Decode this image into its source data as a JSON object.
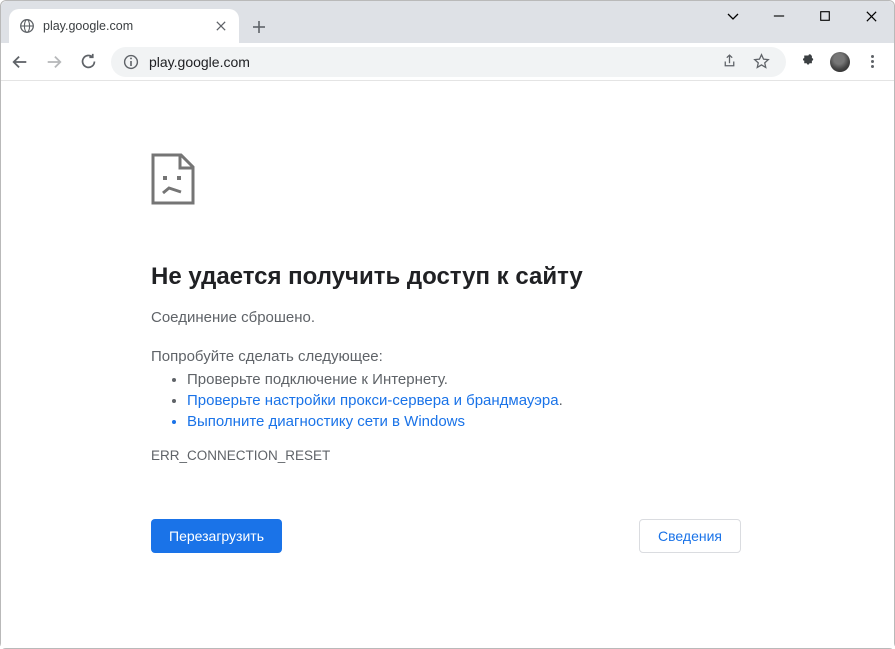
{
  "window": {
    "tab_title": "play.google.com"
  },
  "toolbar": {
    "url": "play.google.com"
  },
  "error": {
    "title": "Не удается получить доступ к сайту",
    "message": "Соединение сброшено.",
    "try_label": "Попробуйте сделать следующее:",
    "suggestions": [
      "Проверьте подключение к Интернету.",
      "Проверьте настройки прокси-сервера и брандмауэра",
      "Выполните диагностику сети в Windows"
    ],
    "suggestion2_trailing_period": ".",
    "code": "ERR_CONNECTION_RESET",
    "reload_label": "Перезагрузить",
    "details_label": "Сведения"
  }
}
